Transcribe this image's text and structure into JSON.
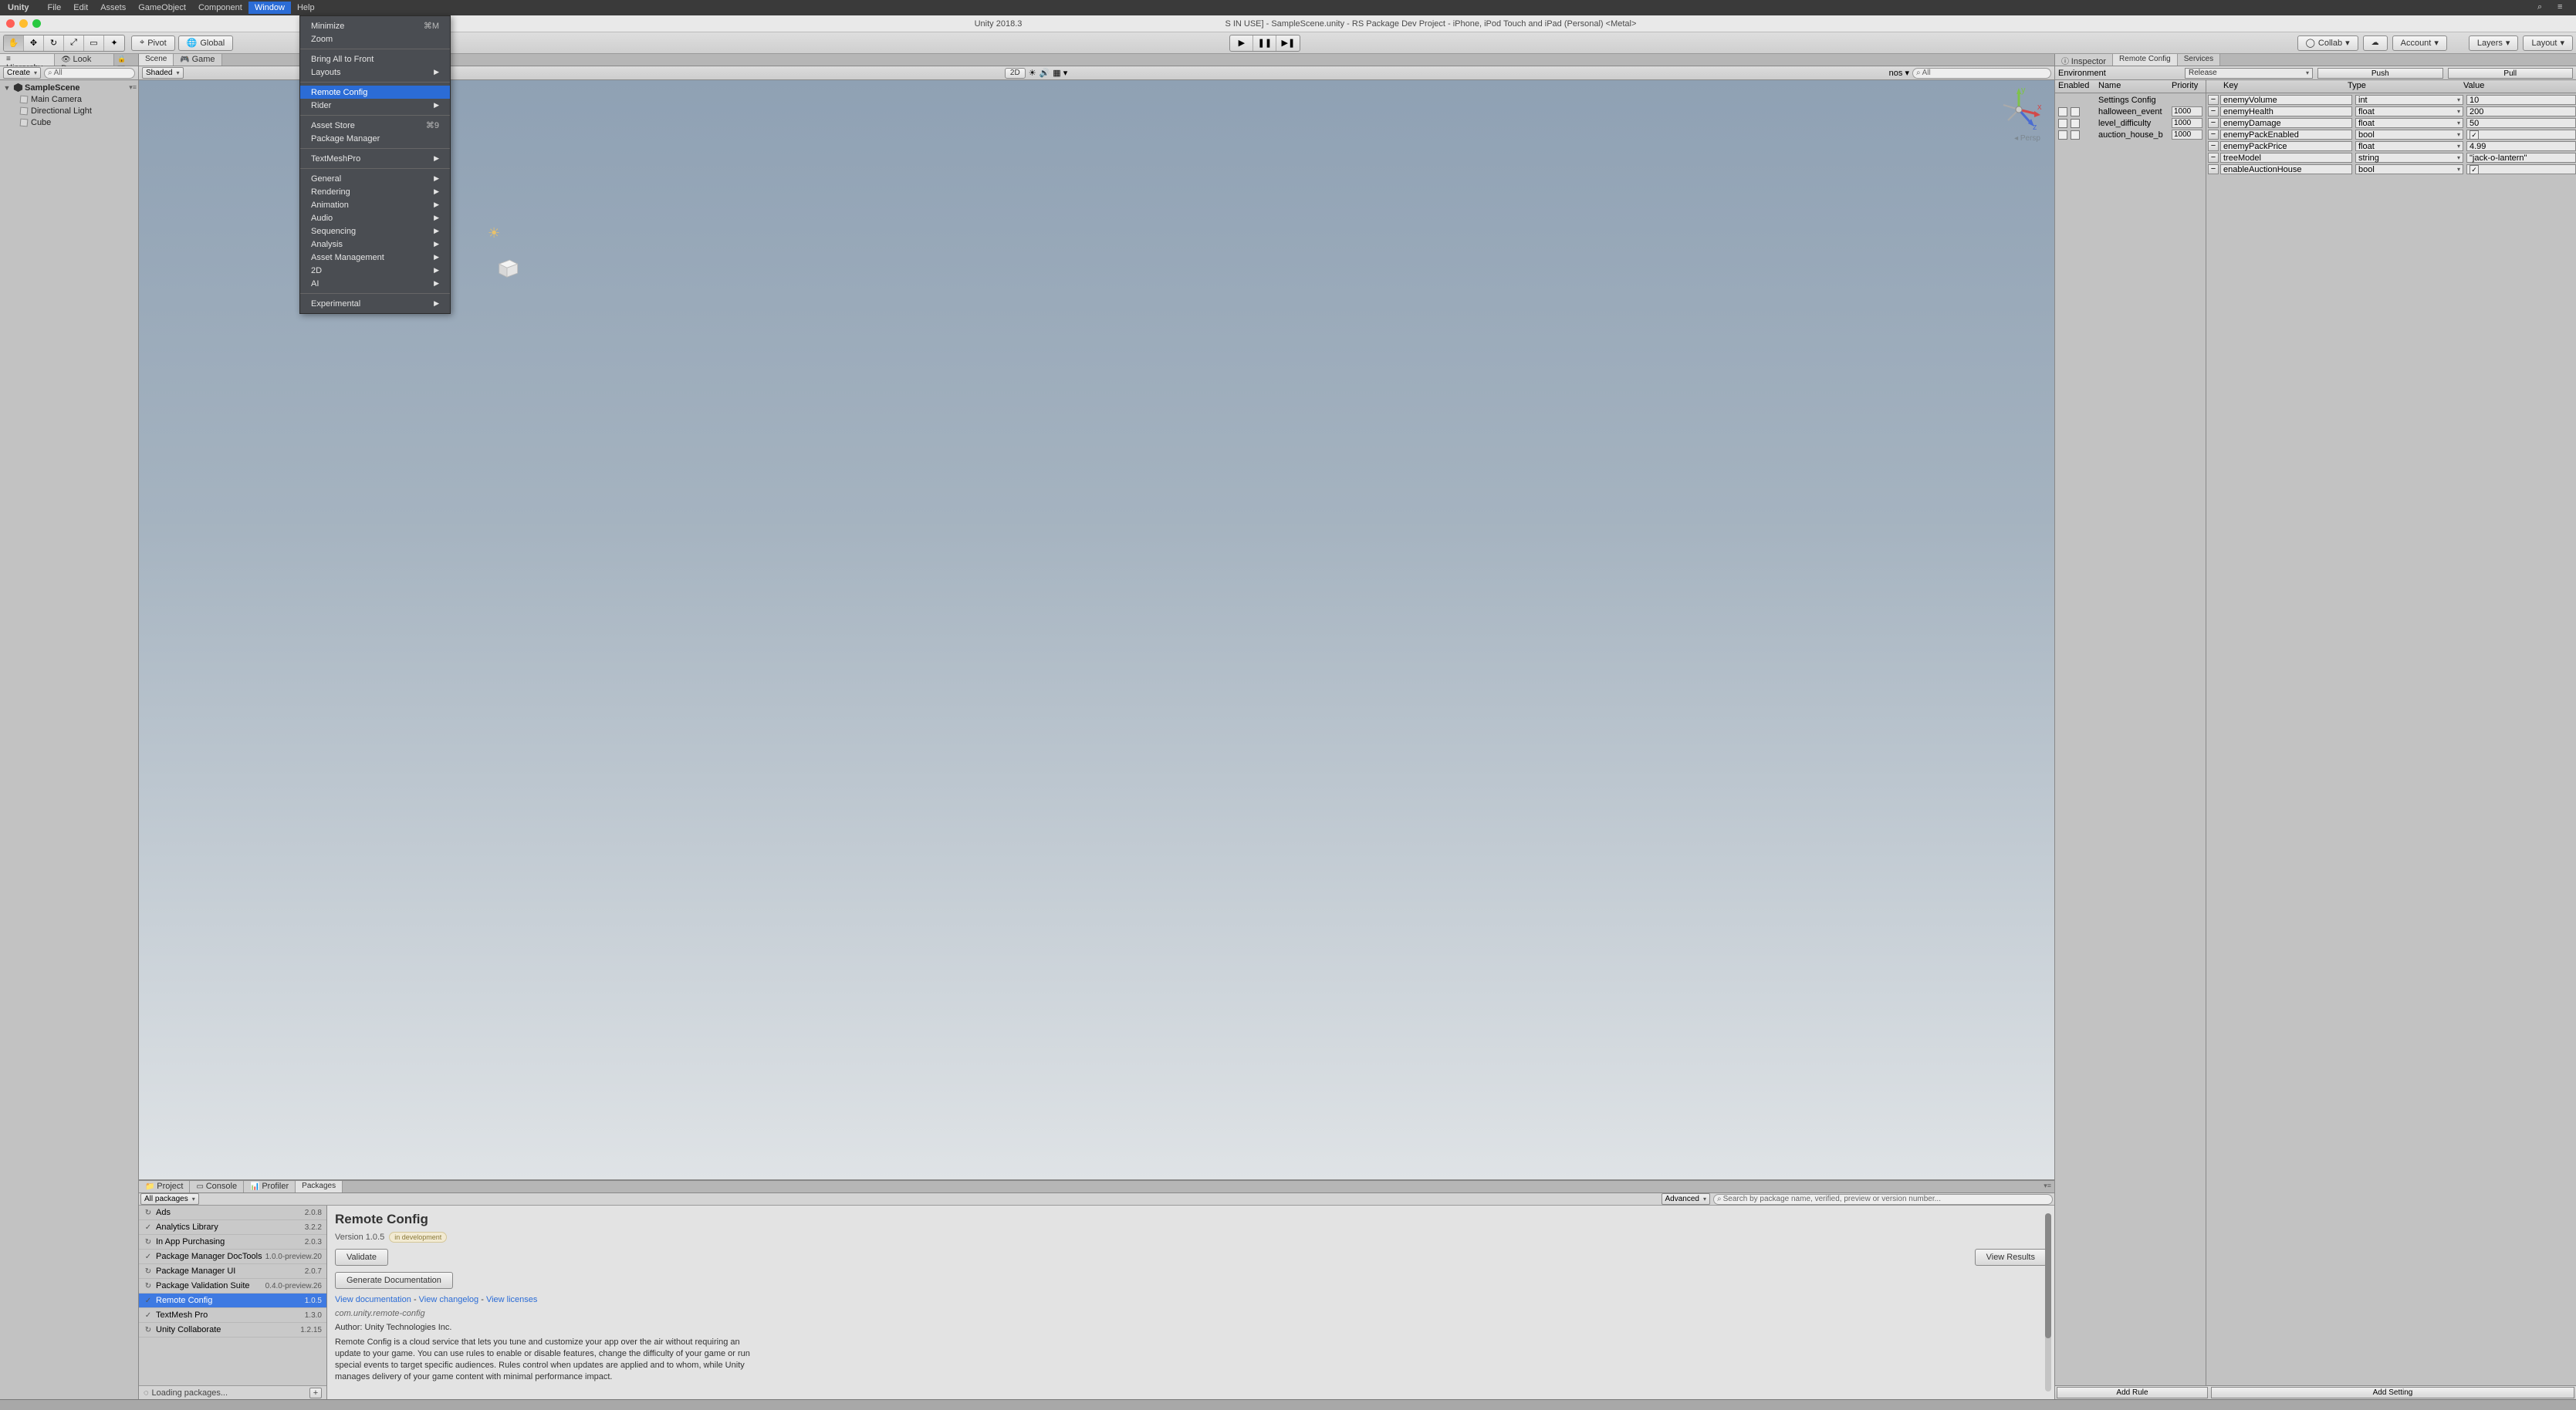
{
  "menubar": {
    "app": "Unity",
    "items": [
      "File",
      "Edit",
      "Assets",
      "GameObject",
      "Component",
      "Window",
      "Help"
    ],
    "active_index": 5
  },
  "titlebar": {
    "prefix": "Unity 2018.3",
    "main": "S IN USE] - SampleScene.unity - RS Package Dev Project - iPhone, iPod Touch and iPad (Personal) <Metal>"
  },
  "toolbar": {
    "pivot": "Pivot",
    "global": "Global",
    "collab": "Collab",
    "account": "Account",
    "layers": "Layers",
    "layout": "Layout"
  },
  "hierarchy": {
    "tab1": "Hierarchy",
    "tab2": "Look Dev",
    "create": "Create",
    "search_placeholder": "All",
    "scene": "SampleScene",
    "children": [
      "Main Camera",
      "Directional Light",
      "Cube"
    ]
  },
  "scene_tabs": {
    "scene": "Scene",
    "game": "Game"
  },
  "scene_bar": {
    "shaded": "Shaded",
    "twod": "2D",
    "search_placeholder": "All",
    "gizmos_suffix": "nos"
  },
  "scene_view": {
    "persp": "Persp",
    "axes": {
      "x": "x",
      "y": "y",
      "z": "z"
    }
  },
  "bottom_tabs": {
    "project": "Project",
    "console": "Console",
    "profiler": "Profiler",
    "packages": "Packages"
  },
  "pkg_filter": {
    "all": "All packages",
    "advanced": "Advanced",
    "search_placeholder": "Search by package name, verified, preview or version number..."
  },
  "packages": [
    {
      "icon": "↻",
      "name": "Ads",
      "ver": "2.0.8"
    },
    {
      "icon": "✓",
      "name": "Analytics Library",
      "ver": "3.2.2"
    },
    {
      "icon": "↻",
      "name": "In App Purchasing",
      "ver": "2.0.3"
    },
    {
      "icon": "✓",
      "name": "Package Manager DocTools",
      "ver": "1.0.0-preview.20"
    },
    {
      "icon": "↻",
      "name": "Package Manager UI",
      "ver": "2.0.7"
    },
    {
      "icon": "↻",
      "name": "Package Validation Suite",
      "ver": "0.4.0-preview.26"
    },
    {
      "icon": "✓",
      "name": "Remote Config",
      "ver": "1.0.5",
      "selected": true
    },
    {
      "icon": "✓",
      "name": "TextMesh Pro",
      "ver": "1.3.0"
    },
    {
      "icon": "↻",
      "name": "Unity Collaborate",
      "ver": "1.2.15"
    }
  ],
  "pkg_status": "Loading packages...",
  "pkg_detail": {
    "title": "Remote Config",
    "version": "Version 1.0.5",
    "badge": "in development",
    "validate": "Validate",
    "view_results": "View Results",
    "gen_doc": "Generate Documentation",
    "link_doc": "View documentation",
    "link_changelog": "View changelog",
    "link_licenses": "View licenses",
    "pkg_id": "com.unity.remote-config",
    "author": "Author: Unity Technologies Inc.",
    "desc": "Remote Config is a cloud service that lets you tune and customize your app over the air without requiring an update to your game.  You can use rules to enable or disable features, change the difficulty of your game or run special events to target specific audiences.  Rules control when updates are applied and to whom, while Unity manages delivery of your game content with minimal performance impact."
  },
  "inspector": {
    "tab_inspector": "Inspector",
    "tab_rc": "Remote Config",
    "tab_services": "Services",
    "env_label": "Environment",
    "env_value": "Release",
    "push": "Push",
    "pull": "Pull"
  },
  "rules_header": {
    "enabled": "Enabled",
    "name": "Name",
    "priority": "Priority"
  },
  "rules": [
    {
      "name": "Settings Config",
      "pri": ""
    },
    {
      "name": "halloween_event",
      "pri": "1000"
    },
    {
      "name": "level_difficulty",
      "pri": "1000"
    },
    {
      "name": "auction_house_b",
      "pri": "1000"
    }
  ],
  "settings_header": {
    "key": "Key",
    "type": "Type",
    "value": "Value"
  },
  "settings": [
    {
      "key": "enemyVolume",
      "type": "int",
      "value": "10"
    },
    {
      "key": "enemyHealth",
      "type": "float",
      "value": "200"
    },
    {
      "key": "enemyDamage",
      "type": "float",
      "value": "50"
    },
    {
      "key": "enemyPackEnabled",
      "type": "bool",
      "value_bool": true
    },
    {
      "key": "enemyPackPrice",
      "type": "float",
      "value": "4.99"
    },
    {
      "key": "treeModel",
      "type": "string",
      "value": "\"jack-o-lantern\""
    },
    {
      "key": "enableAuctionHouse",
      "type": "bool",
      "value_bool": true
    }
  ],
  "rc_footer": {
    "add_rule": "Add Rule",
    "add_setting": "Add Setting"
  },
  "window_menu": [
    {
      "label": "Minimize",
      "shortcut": "⌘M"
    },
    {
      "label": "Zoom"
    },
    {
      "sep": true
    },
    {
      "label": "Bring All to Front"
    },
    {
      "label": "Layouts",
      "sub": true
    },
    {
      "sep": true
    },
    {
      "label": "Remote Config",
      "hl": true
    },
    {
      "label": "Rider",
      "sub": true
    },
    {
      "sep": true
    },
    {
      "label": "Asset Store",
      "shortcut": "⌘9"
    },
    {
      "label": "Package Manager"
    },
    {
      "sep": true
    },
    {
      "label": "TextMeshPro",
      "sub": true
    },
    {
      "sep": true
    },
    {
      "label": "General",
      "sub": true
    },
    {
      "label": "Rendering",
      "sub": true
    },
    {
      "label": "Animation",
      "sub": true
    },
    {
      "label": "Audio",
      "sub": true
    },
    {
      "label": "Sequencing",
      "sub": true
    },
    {
      "label": "Analysis",
      "sub": true
    },
    {
      "label": "Asset Management",
      "sub": true
    },
    {
      "label": "2D",
      "sub": true
    },
    {
      "label": "AI",
      "sub": true
    },
    {
      "sep": true
    },
    {
      "label": "Experimental",
      "sub": true
    }
  ]
}
